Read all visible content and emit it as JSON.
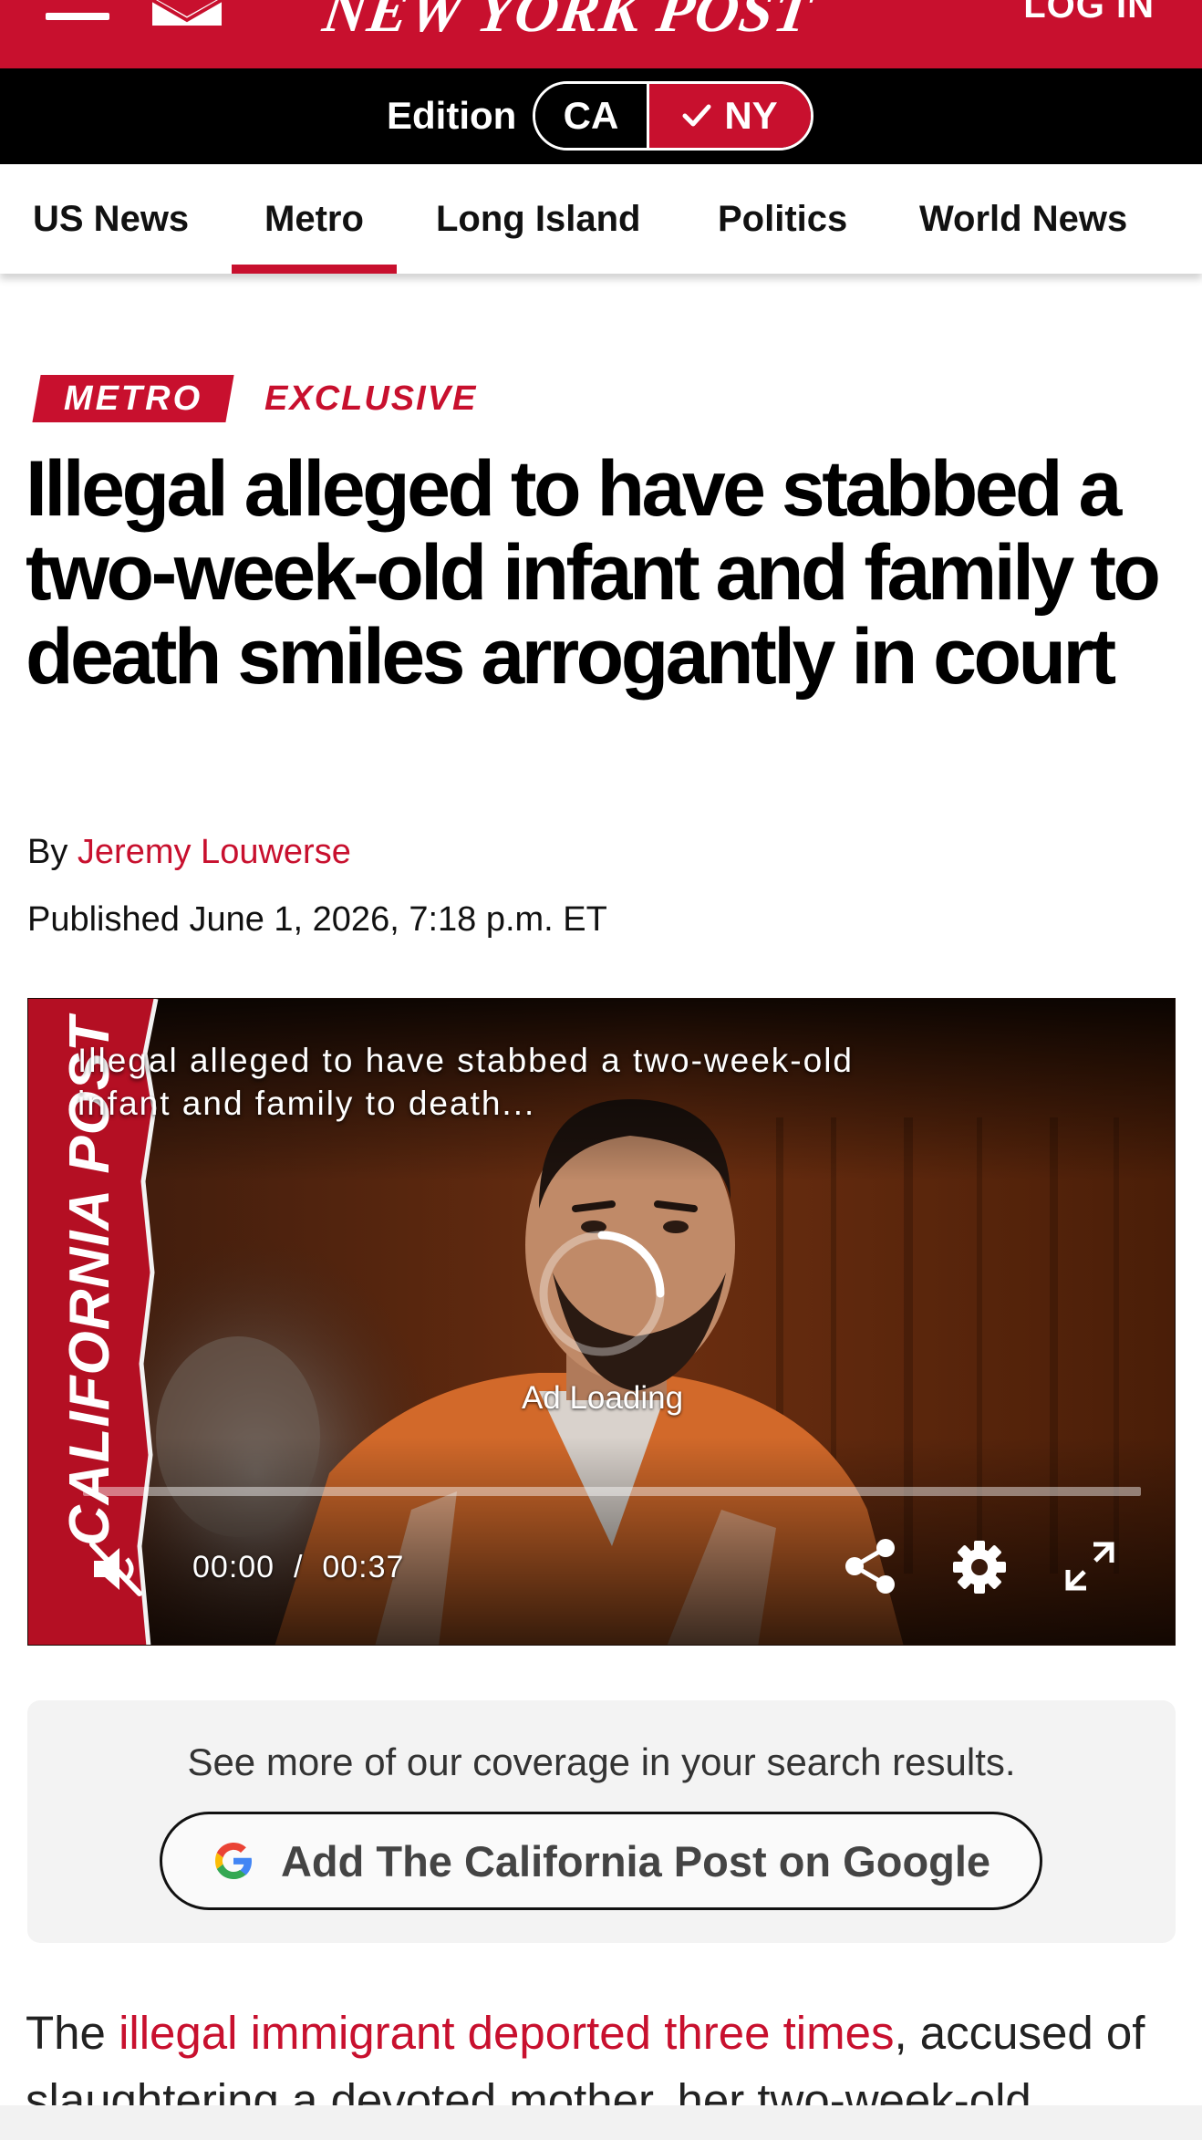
{
  "masthead": {
    "logo_text": "NEW YORK POST",
    "login_label": "LOG IN",
    "menu_icon": "hamburger-menu-icon",
    "mail_icon": "mail-icon",
    "brand_color": "#c8102e"
  },
  "edition": {
    "label": "Edition",
    "options": [
      "CA",
      "NY"
    ],
    "selected": "NY"
  },
  "nav": {
    "items": [
      "US News",
      "Metro",
      "Long Island",
      "Politics",
      "World News"
    ],
    "active": "Metro"
  },
  "article": {
    "section_tag": "METRO",
    "exclusive_tag": "EXCLUSIVE",
    "headline": "Illegal alleged to have stabbed a two-week-old infant and family to death smiles arrogantly in court",
    "byline_prefix": "By",
    "author": "Jeremy Louwerse",
    "published": "Published June 1, 2026, 7:18 p.m. ET"
  },
  "video": {
    "title": "Illegal alleged to have stabbed a two-week-old infant and family to death...",
    "brand_text": "CALIFORNIA POST",
    "status": "Ad Loading",
    "current_time": "00:00",
    "separator": "/",
    "duration": "00:37",
    "progress": 0,
    "controls": [
      "muted-speaker-icon",
      "share-icon",
      "settings-gear-icon",
      "fullscreen-icon"
    ]
  },
  "promo": {
    "text": "See more of our coverage in your search results.",
    "button_label": "Add The California Post on Google",
    "button_icon": "google-g-icon"
  },
  "body": {
    "lead": "The ",
    "link_text": "illegal immigrant deported three times",
    "rest": ", accused of slaughtering a devoted mother, her two-week-old"
  }
}
